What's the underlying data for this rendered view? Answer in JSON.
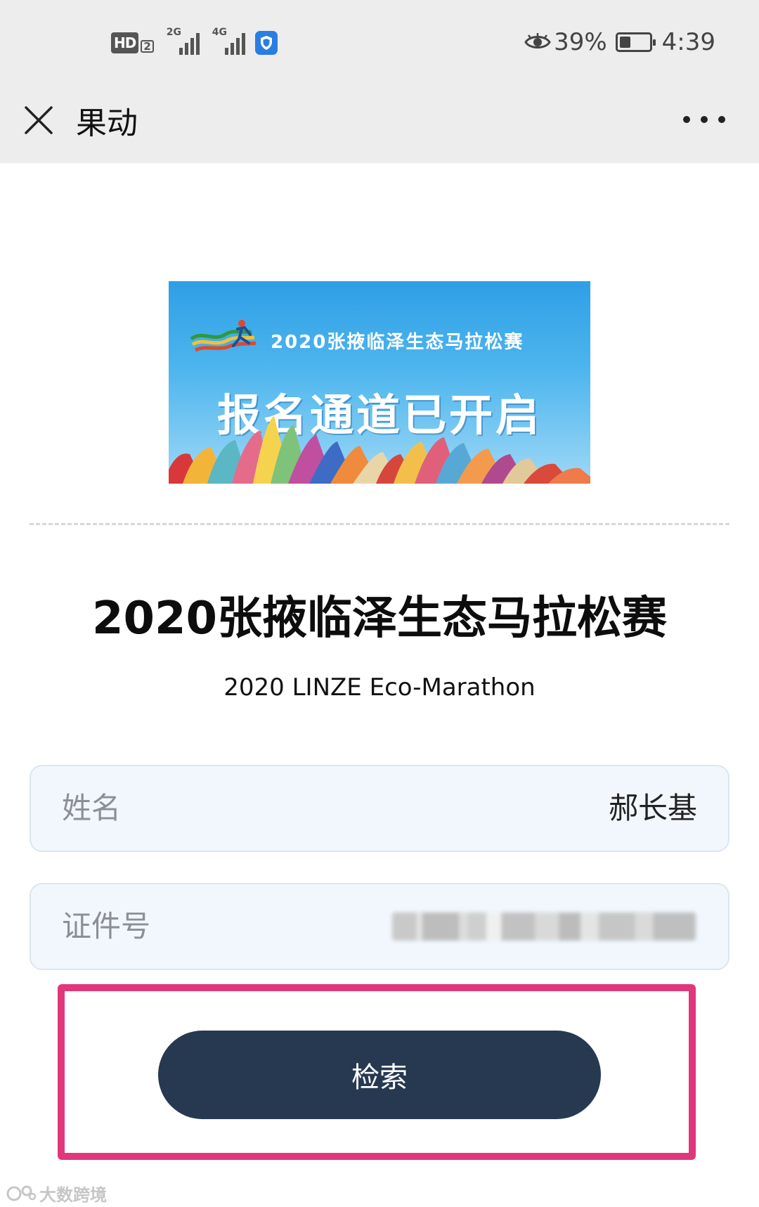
{
  "status_bar": {
    "hd_label": "HD",
    "hd_sub": "2",
    "signal_1_label": "2G",
    "signal_2_label": "4G",
    "battery_percent": "39%",
    "battery_level": 0.39,
    "time": "4:39",
    "icons": [
      "hd-icon",
      "signal-icon",
      "signal-icon",
      "shield-icon",
      "eye-icon",
      "battery-icon"
    ]
  },
  "app_bar": {
    "title": "果动",
    "close_icon": "close-icon",
    "more_icon": "more-icon"
  },
  "banner": {
    "event_name": "2020张掖临泽生态马拉松赛",
    "headline": "报名通道已开启"
  },
  "event": {
    "title": "2020张掖临泽生态马拉松赛",
    "subtitle": "2020 LINZE Eco-Marathon"
  },
  "form": {
    "name_label": "姓名",
    "name_value": "郝长基",
    "id_label": "证件号",
    "search_button": "检索"
  },
  "watermark": {
    "text": "大数跨境"
  },
  "colors": {
    "title_bar_bg": "#ededed",
    "field_bg": "#f1f7fd",
    "button_bg": "#263950",
    "highlight": "#e0377a",
    "banner_sky": "#2e9fe6"
  }
}
